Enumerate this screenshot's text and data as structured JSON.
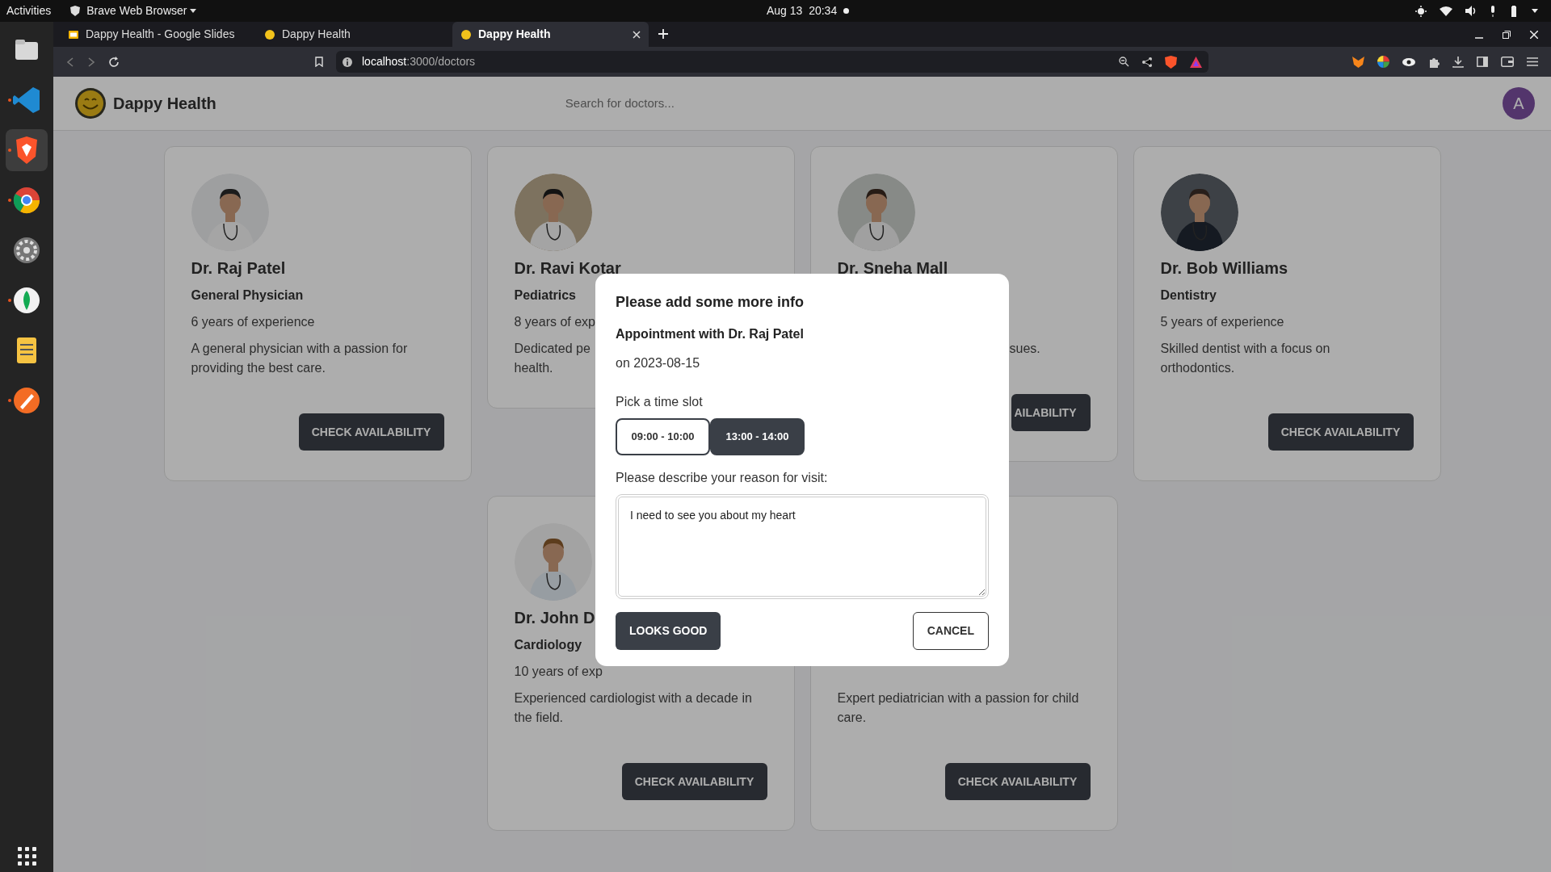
{
  "system_bar": {
    "activities": "Activities",
    "app_menu": "Brave Web Browser",
    "clock": "Aug 13  20:34"
  },
  "dock": [
    {
      "kind": "files",
      "running": false,
      "focused": false
    },
    {
      "kind": "code",
      "running": true,
      "focused": false
    },
    {
      "kind": "brave",
      "running": true,
      "focused": true
    },
    {
      "kind": "chrome",
      "running": true,
      "focused": false
    },
    {
      "kind": "settings",
      "running": false,
      "focused": false
    },
    {
      "kind": "leaf",
      "running": true,
      "focused": false
    },
    {
      "kind": "notes",
      "running": false,
      "focused": false
    },
    {
      "kind": "pen",
      "running": true,
      "focused": false
    }
  ],
  "browser": {
    "tabs": [
      {
        "title": "Dappy Health - Google Slides",
        "selected": false
      },
      {
        "title": "Dappy Health",
        "selected": false
      },
      {
        "title": "Dappy Health",
        "selected": true
      }
    ],
    "url_host": "localhost",
    "url_path": ":3000/doctors"
  },
  "app": {
    "brand": "Dappy Health",
    "search": {
      "placeholder": "Search for doctors..."
    },
    "avatar": "A"
  },
  "doctors": [
    {
      "name": "Dr. Raj Patel",
      "specialty": "General Physician",
      "experience": "6 years of experience",
      "description": "A general physician with a passion for providing the best care.",
      "button": "CHECK AVAILABILITY"
    },
    {
      "name": "Dr. Ravi Kotar",
      "specialty": "Pediatrics",
      "experience": "8 years of exp",
      "description": "Dedicated pe",
      "description_2": "health."
    },
    {
      "name": "Dr. Sneha Mall",
      "kind": "covered_left",
      "description": "sues.",
      "button": "AILABILITY"
    },
    {
      "name": "Dr. Bob Williams",
      "specialty": "Dentistry",
      "experience": "5 years of experience",
      "description": "Skilled dentist with a focus on orthodontics.",
      "button": "CHECK AVAILABILITY"
    },
    {
      "name": "Dr. John D",
      "specialty": "Cardiology",
      "experience": "10 years of exp",
      "description": "Experienced cardiologist with a decade in the field.",
      "button": "CHECK AVAILABILITY"
    },
    {
      "description": "Expert pediatrician with a passion for child care.",
      "button": "CHECK AVAILABILITY"
    }
  ],
  "modal": {
    "title": "Please add some more info",
    "subtitle": "Appointment with Dr. Raj Patel",
    "date": "on 2023-08-15",
    "slot_label": "Pick a time slot",
    "slots": [
      {
        "label": "09:00 - 10:00",
        "selected": false
      },
      {
        "label": "13:00 - 14:00",
        "selected": true
      }
    ],
    "reason_label": "Please describe your reason for visit:",
    "reason_value": "I need to see you about my heart",
    "confirm": "LOOKS GOOD",
    "cancel": "CANCEL"
  }
}
